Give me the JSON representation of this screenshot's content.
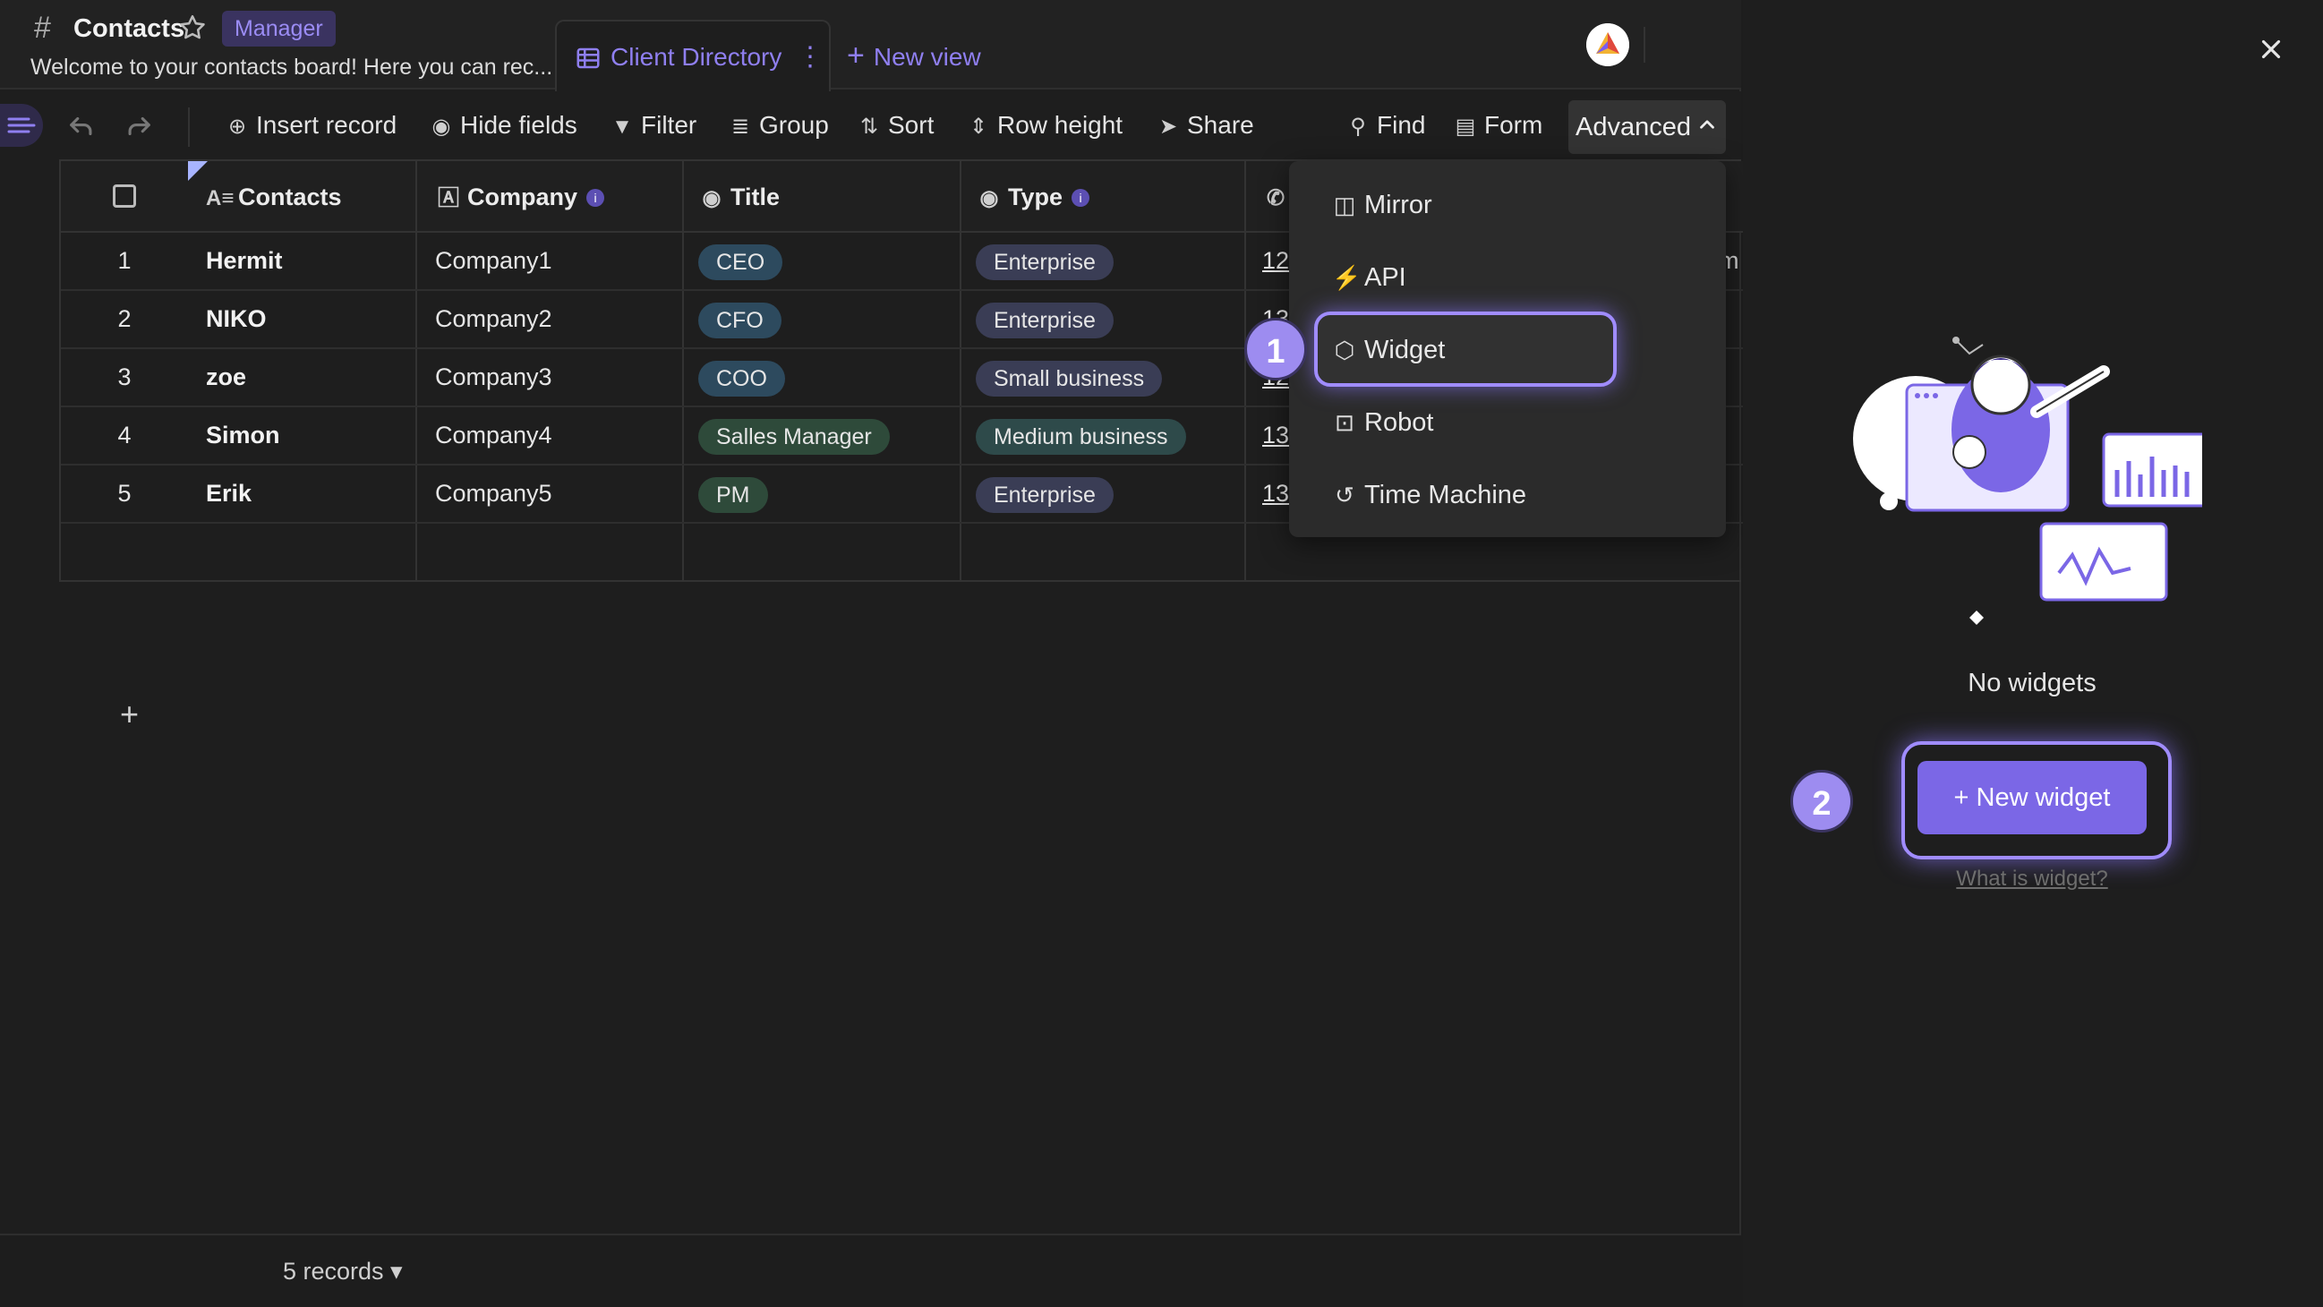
{
  "header": {
    "board_title": "Contacts",
    "role_badge": "Manager",
    "description": "Welcome to your contacts board! Here you can rec...",
    "view_tab": "Client Directory",
    "new_view": "New view",
    "more_icon": "⋮"
  },
  "toolbar": {
    "insert_record": "Insert record",
    "hide_fields": "Hide fields",
    "filter": "Filter",
    "group": "Group",
    "sort": "Sort",
    "row_height": "Row height",
    "share": "Share",
    "find": "Find",
    "form": "Form",
    "advanced": "Advanced"
  },
  "table": {
    "columns": [
      "Contacts",
      "Company",
      "Title",
      "Type"
    ],
    "rows": [
      {
        "num": "1",
        "contact": "Hermit",
        "company": "Company1",
        "title": "CEO",
        "type": "Enterprise",
        "phone": "12"
      },
      {
        "num": "2",
        "contact": "NIKO",
        "company": "Company2",
        "title": "CFO",
        "type": "Enterprise",
        "phone": "13"
      },
      {
        "num": "3",
        "contact": "zoe",
        "company": "Company3",
        "title": "COO",
        "type": "Small business",
        "phone": "12"
      },
      {
        "num": "4",
        "contact": "Simon",
        "company": "Company4",
        "title": "Salles Manager",
        "type": "Medium business",
        "phone": "13"
      },
      {
        "num": "5",
        "contact": "Erik",
        "company": "Company5",
        "title": "PM",
        "type": "Enterprise",
        "phone": "13"
      }
    ],
    "add_row": "+",
    "overflow_char": "m"
  },
  "footer": {
    "records": "5 records ▾"
  },
  "dropdown": {
    "items": [
      "Mirror",
      "API",
      "Widget",
      "Robot",
      "Time Machine"
    ]
  },
  "steps": [
    "1",
    "2"
  ],
  "panel": {
    "empty_text": "No widgets",
    "new_widget": "+ New widget",
    "what_link": "What is widget?",
    "close": "×"
  },
  "colors": {
    "accent": "#8f7ff0",
    "button": "#7b67e6",
    "badge": "#9d8cf0",
    "title_pill_blue": "#2d4a5e",
    "title_pill_green": "#2e4a3a",
    "type_pill": "#3a3d55"
  }
}
